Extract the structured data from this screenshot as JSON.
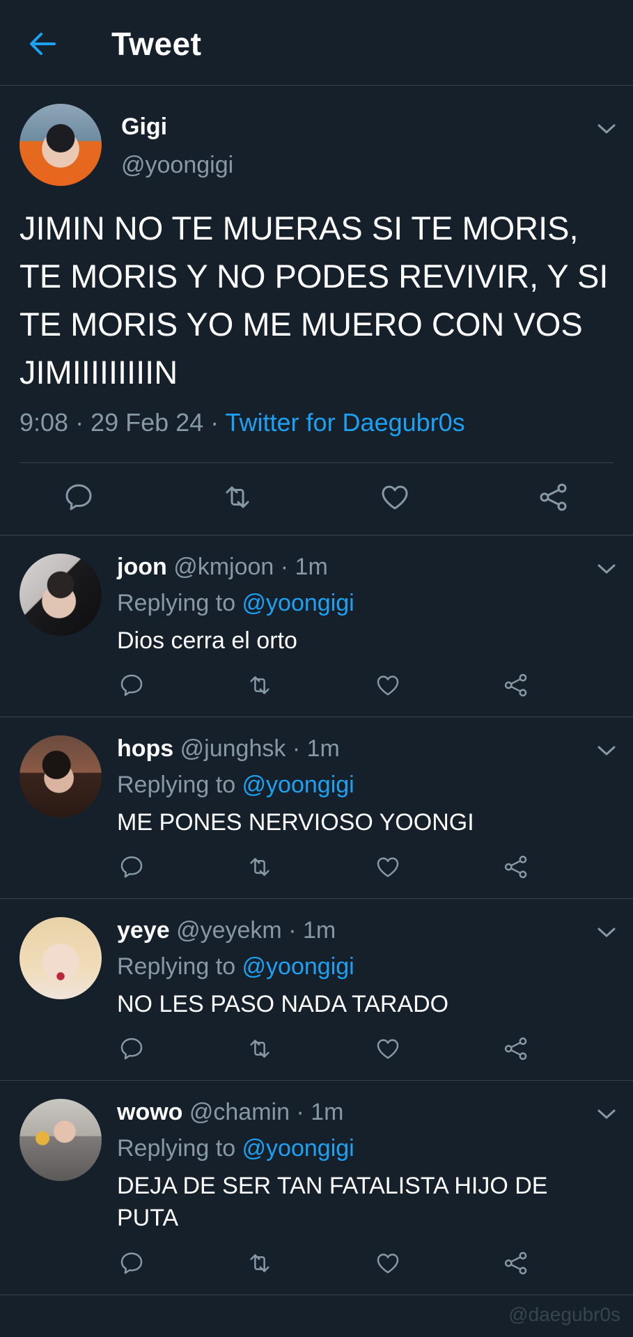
{
  "header": {
    "title": "Tweet",
    "back_icon": "arrow-left-icon"
  },
  "colors": {
    "background": "#15202b",
    "accent": "#1da1f2",
    "muted": "#8899a6",
    "divider": "#38444d"
  },
  "main_tweet": {
    "name": "Gigi",
    "handle": "@yoongigi",
    "text": "JIMIN NO TE MUERAS SI TE MORIS, TE MORIS Y NO PODES REVIVIR, Y SI TE MORIS YO ME MUERO CON VOS JIMIIIIIIIIIN",
    "time": "9:08 · 29 Feb 24 · ",
    "source": "Twitter for Daegubr0s"
  },
  "replies": [
    {
      "name": "joon",
      "meta": " @kmjoon · 1m",
      "replying_prefix": "Replying to ",
      "mention": "@yoongigi",
      "text": "Dios cerra el orto"
    },
    {
      "name": "hops",
      "meta": " @junghsk · 1m",
      "replying_prefix": "Replying to ",
      "mention": "@yoongigi",
      "text": "ME PONES NERVIOSO YOONGI"
    },
    {
      "name": "yeye",
      "meta": " @yeyekm · 1m",
      "replying_prefix": "Replying to ",
      "mention": "@yoongigi",
      "text": "NO LES PASO NADA TARADO"
    },
    {
      "name": "wowo",
      "meta": " @chamin · 1m",
      "replying_prefix": "Replying to ",
      "mention": "@yoongigi",
      "text": "DEJA DE SER TAN FATALISTA HIJO DE PUTA"
    }
  ],
  "watermark": "@daegubr0s"
}
